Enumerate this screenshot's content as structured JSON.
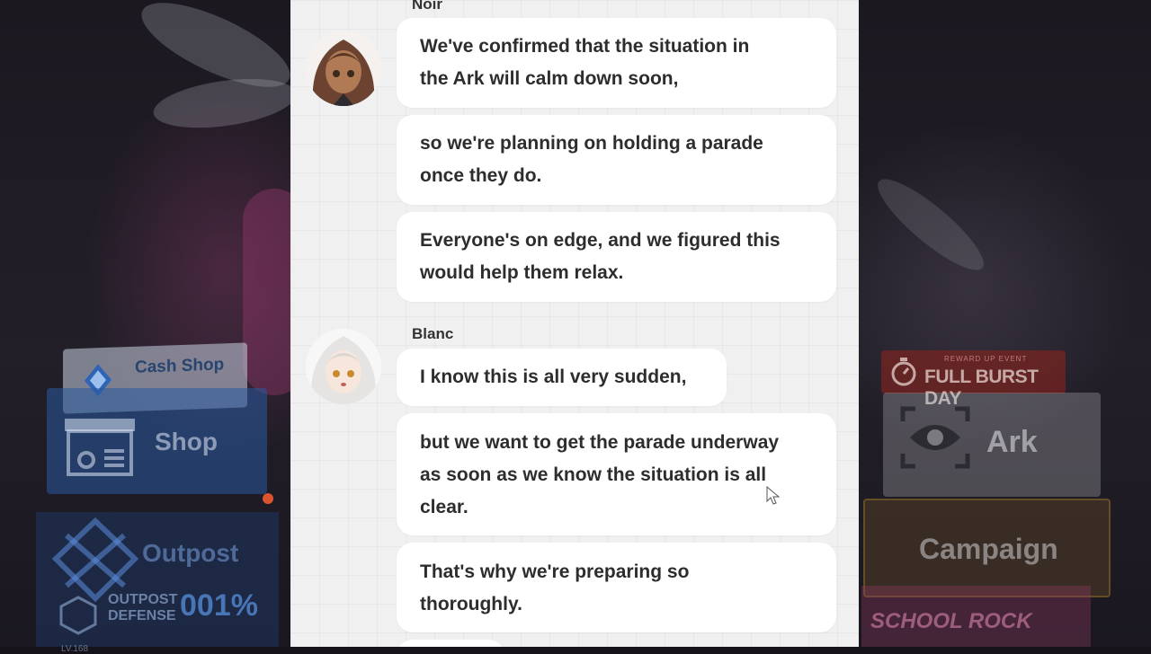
{
  "background": {
    "left_menu": {
      "cash_shop_label": "Cash Shop",
      "shop_label": "Shop",
      "outpost_label": "Outpost",
      "outpost_defense_label": "OUTPOST DEFENSE",
      "outpost_defense_percent": "001%",
      "outpost_level": "LV.168"
    },
    "right_menu": {
      "event_sub_label": "REWARD UP EVENT",
      "event_label": "FULL BURST DAY",
      "ark_label": "Ark",
      "campaign_label": "Campaign",
      "banner_label": "SCHOOL ROCK"
    }
  },
  "chat": {
    "messages": [
      {
        "sender": "Noir",
        "bubbles": [
          [
            "We've confirmed that the situation in",
            "the Ark will calm down soon,"
          ],
          [
            "so we're planning on holding a parade",
            "once they do."
          ],
          [
            "Everyone's on edge, and we figured this",
            "would help them relax."
          ]
        ]
      },
      {
        "sender": "Blanc",
        "bubbles": [
          [
            "I know this is all very sudden,"
          ],
          [
            "but we want to get the parade underway",
            "as soon as we know the situation is all",
            "clear."
          ],
          [
            "That's why we're preparing so",
            "thoroughly."
          ]
        ]
      }
    ]
  },
  "colors": {
    "panel_bg": "#f0f0f0",
    "bubble_bg": "#ffffff",
    "text": "#2d2d2d",
    "notification_dot": "#d9552f"
  }
}
